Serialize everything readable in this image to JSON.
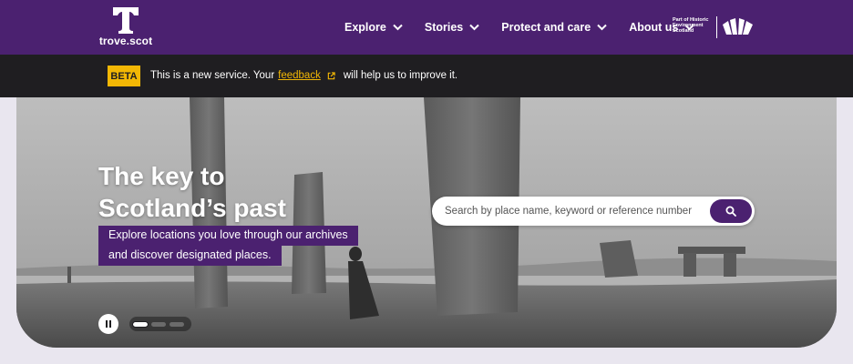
{
  "header": {
    "logo_text": "trove.scot",
    "nav": [
      {
        "label": "Explore"
      },
      {
        "label": "Stories"
      },
      {
        "label": "Protect and care"
      },
      {
        "label": "About us"
      }
    ],
    "partner": {
      "line1": "Part of Historic",
      "line2": "Environment",
      "line3": "Scotland"
    }
  },
  "beta_banner": {
    "tag": "BETA",
    "text_before": "This is a new service. Your",
    "link": "feedback",
    "text_after": "will help us to improve it."
  },
  "hero": {
    "title_line1": "The key to",
    "title_line2": "Scotland’s past",
    "subtitle_line1": "Explore locations you love through our archives",
    "subtitle_line2": "and discover designated places.",
    "search_placeholder": "Search by place name, keyword or reference number",
    "carousel": {
      "slides": 3,
      "active": 1
    }
  },
  "colors": {
    "brand_purple": "#4b2170",
    "beta_yellow": "#f2b705",
    "banner_dark": "#1f1e21"
  }
}
